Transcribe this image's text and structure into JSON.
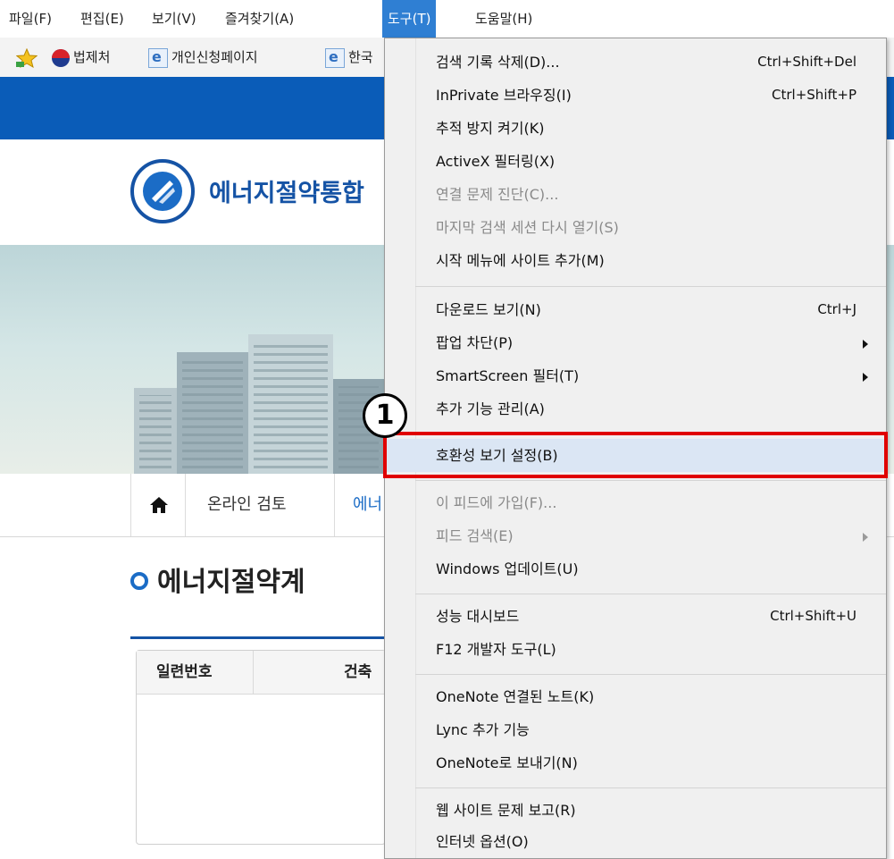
{
  "menubar": {
    "items": [
      "파일(F)",
      "편집(E)",
      "보기(V)",
      "즐겨찾기(A)",
      "도구(T)",
      "도움말(H)"
    ]
  },
  "favorites": {
    "items": [
      "법제처",
      "개인신청페이지",
      "한국"
    ]
  },
  "site": {
    "logo_title": "에너지절약통합",
    "nav": {
      "item1": "온라인 검토",
      "item2_partial": "에너"
    },
    "page_title": "에너지절약계",
    "table": {
      "col1": "일련번호",
      "col2_partial": "건축"
    }
  },
  "tools_menu": {
    "items": [
      {
        "label": "검색 기록 삭제(D)...",
        "shortcut": "Ctrl+Shift+Del"
      },
      {
        "label": "InPrivate 브라우징(I)",
        "shortcut": "Ctrl+Shift+P"
      },
      {
        "label": "추적 방지 켜기(K)",
        "shortcut": ""
      },
      {
        "label": "ActiveX 필터링(X)",
        "shortcut": ""
      },
      {
        "label": "연결 문제 진단(C)...",
        "shortcut": ""
      },
      {
        "label": "마지막 검색 세션 다시 열기(S)",
        "shortcut": ""
      },
      {
        "label": "시작 메뉴에 사이트 추가(M)",
        "shortcut": ""
      },
      {
        "label": "다운로드 보기(N)",
        "shortcut": "Ctrl+J"
      },
      {
        "label": "팝업 차단(P)",
        "shortcut": ""
      },
      {
        "label": "SmartScreen 필터(T)",
        "shortcut": ""
      },
      {
        "label": "추가 기능 관리(A)",
        "shortcut": ""
      },
      {
        "label": "호환성 보기 설정(B)",
        "shortcut": ""
      },
      {
        "label": "이 피드에 가입(F)...",
        "shortcut": ""
      },
      {
        "label": "피드 검색(E)",
        "shortcut": ""
      },
      {
        "label": "Windows 업데이트(U)",
        "shortcut": ""
      },
      {
        "label": "성능 대시보드",
        "shortcut": "Ctrl+Shift+U"
      },
      {
        "label": "F12 개발자 도구(L)",
        "shortcut": ""
      },
      {
        "label": "OneNote 연결된 노트(K)",
        "shortcut": ""
      },
      {
        "label": "Lync 추가 기능",
        "shortcut": ""
      },
      {
        "label": "OneNote로 보내기(N)",
        "shortcut": ""
      },
      {
        "label": "웹 사이트 문제 보고(R)",
        "shortcut": ""
      },
      {
        "label": "인터넷 옵션(O)",
        "shortcut": ""
      }
    ]
  },
  "annotation": {
    "step": "1"
  },
  "colors": {
    "accent": "#2f7fd3",
    "site_blue": "#0a5cb8",
    "highlight_red": "#e00000"
  }
}
